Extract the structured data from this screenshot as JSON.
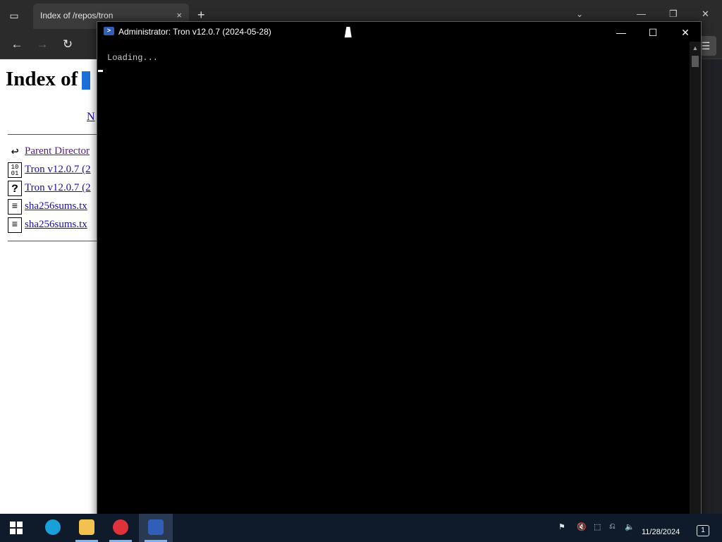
{
  "browser": {
    "tab": {
      "title": "Index of /repos/tron",
      "close_icon": "×"
    },
    "new_tab_icon": "+",
    "tab_list_icon": "⌄",
    "window_controls": {
      "minimize": "—",
      "restore": "❐",
      "close": "✕"
    },
    "nav": {
      "back": "←",
      "forward": "→",
      "reload": "↻"
    },
    "menu_icon": "☰",
    "page": {
      "heading": "Index of",
      "column_link": "N",
      "files": [
        {
          "icon": "back-arrow",
          "glyph": "↩",
          "name": "Parent Director",
          "visited": true
        },
        {
          "icon": "binary-file",
          "glyph": "10\n01",
          "name": "Tron v12.0.7 (2",
          "visited": false
        },
        {
          "icon": "unknown-file",
          "glyph": "?",
          "name": "Tron v12.0.7 (2",
          "visited": false
        },
        {
          "icon": "text-file",
          "glyph": "≡",
          "name": "sha256sums.tx",
          "visited": false
        },
        {
          "icon": "text-file",
          "glyph": "≡",
          "name": "sha256sums.tx",
          "visited": false
        }
      ]
    }
  },
  "console": {
    "title": "Administrator:  Tron v12.0.7 (2024-05-28)",
    "ps_icon": ">",
    "controls": {
      "minimize": "—",
      "maximize": "☐",
      "close": "✕"
    },
    "output": "Loading...",
    "scroll_up": "▲",
    "scroll_down": "▼"
  },
  "taskbar": {
    "apps": [
      {
        "name": "edge",
        "color": "#1aa0d8"
      },
      {
        "name": "file-explorer",
        "color": "#f2c14e"
      },
      {
        "name": "opera",
        "color": "#e0323a"
      },
      {
        "name": "terminal",
        "color": "#2f5fb8"
      }
    ],
    "tray_icons": [
      "⚑",
      "🔇",
      "⬚",
      "⎌",
      "🔈"
    ],
    "clock_date": "11/28/2024",
    "notification_count": "1"
  },
  "colors": {
    "accent": "#1e6fd9",
    "console_bg": "#000000",
    "taskbar_bg": "#0f1a2b",
    "link": "#1a0dab",
    "link_visited": "#551a8b"
  }
}
